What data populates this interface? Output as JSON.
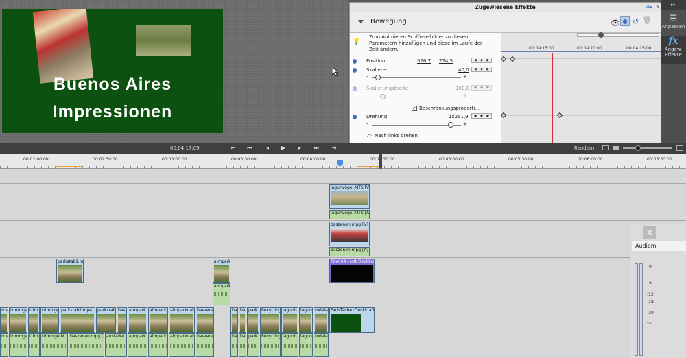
{
  "monitor": {
    "title_line_1": "Buenos Aires",
    "title_line_2": "Impressionen"
  },
  "effects_panel": {
    "title": "Zugewiesene Effekte",
    "section": "Bewegung",
    "tooltip": "Zum Animieren Schlüsselbilder zu diesen Parametern hinzufügen und diese im Laufe der Zeit ändern.",
    "params": {
      "position_label": "Position",
      "position_x": "526,7",
      "position_y": "274,5",
      "scale_label": "Skalieren",
      "scale_value": "40,0",
      "scale_width_label": "Skalierungsbreite",
      "scale_width_value": "100,0",
      "constrain_label": "Beschränkungsproporti...",
      "rotation_label": "Drehung",
      "rotation_value": "1x261,9 °",
      "rotate_left_label": "Nach links drehen"
    },
    "timeline_ticks": [
      "00:04:15:00",
      "00:04:20:00",
      "00:04:25:00"
    ]
  },
  "tool_strip": {
    "adjust_label": "Anpassen",
    "applied_fx_label": "Angew. Effekte",
    "fx_glyph": "fx"
  },
  "transport": {
    "timecode": "00:04:17:09",
    "render_label": "Rendern"
  },
  "ruler": {
    "ticks": [
      "00:02:00:00",
      "00:02:30:00",
      "00:03:00:00",
      "00:03:30:00",
      "00:04:00:00",
      "00:04:30:00",
      "00:05:00:00",
      "00:05:30:00",
      "00:06:00:00",
      "00:06:30:00"
    ]
  },
  "clips": {
    "lagune_v": "lagunvögel.MTS [V]",
    "lagune_a": "lagunvögel.MTS [A]",
    "bas_v": "baszenen.mpg [V] ·",
    "bas_a": "baszenen.mpg [A]",
    "parkstabil": "parkstabil.m",
    "almpark": "almpark",
    "almpark_a": "almpark",
    "titel": "Titel 04  craft:Deckkraft ·",
    "v1_labels": [
      "rriv",
      "trimmge",
      "trim",
      "trimmge",
      "parkstabil.mp4",
      "parkstabi",
      "bas",
      "almpark.7",
      "almparkn",
      "almparknah.",
      "baszene",
      "ba",
      "ba",
      "park",
      "Recycling",
      "lagunb",
      "lagun",
      "rodela",
      "Farbfläche  ·Deckkraft·"
    ],
    "a1_labels": [
      "rriv",
      "trimmge",
      "trim",
      "trimmge.M",
      "baszenen.mpg [A]",
      "austärke ·",
      "almpark.7",
      "almparkn",
      "almparknah.",
      "baszene",
      "ba",
      "ba",
      "park",
      "Recycling",
      "lagunb",
      "lagun",
      "rodela"
    ]
  },
  "mixer": {
    "close_glyph": "×",
    "title": "Audiomi",
    "scale": [
      "0",
      "-6",
      "-12",
      "-18",
      "-30",
      "-∞"
    ]
  }
}
